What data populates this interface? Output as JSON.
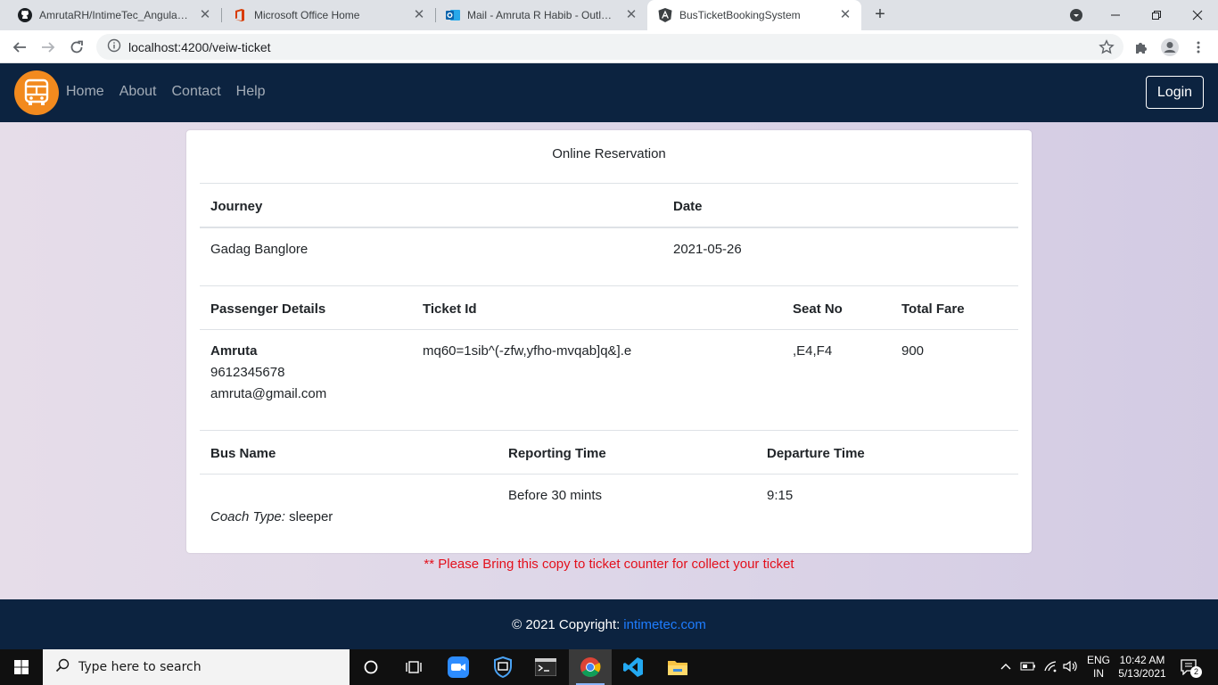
{
  "browser": {
    "tabs": [
      {
        "title": "AmrutaRH/IntimeTec_Angular_Tra"
      },
      {
        "title": "Microsoft Office Home"
      },
      {
        "title": "Mail - Amruta R Habib - Outlook"
      },
      {
        "title": "BusTicketBookingSystem"
      }
    ],
    "url": "localhost:4200/veiw-ticket"
  },
  "navbar": {
    "links": [
      "Home",
      "About",
      "Contact",
      "Help"
    ],
    "login_label": "Login"
  },
  "ticket": {
    "title": "Online Reservation",
    "journey_header": "Journey",
    "date_header": "Date",
    "journey": "Gadag Banglore",
    "date": "2021-05-26",
    "passenger_header": "Passenger Details",
    "ticket_id_header": "Ticket Id",
    "seat_header": "Seat No",
    "fare_header": "Total Fare",
    "passenger_name": "Amruta",
    "passenger_phone": "9612345678",
    "passenger_email": "amruta@gmail.com",
    "ticket_id": "mq60=1sib^(-zfw,yfho-mvqab]q&].e",
    "seat_no": ",E4,F4",
    "total_fare": "900",
    "bus_name_header": "Bus Name",
    "reporting_header": "Reporting Time",
    "departure_header": "Departure Time",
    "coach_type_label": "Coach Type:",
    "coach_type": "sleeper",
    "reporting_time": "Before 30 mints",
    "departure_time": "9:15"
  },
  "notice": "** Please Bring this copy to ticket counter for collect your ticket",
  "footer": {
    "copyright": "© 2021 Copyright:",
    "link": "intimetec.com"
  },
  "taskbar": {
    "search_placeholder": "Type here to search",
    "lang": "ENG",
    "region": "IN",
    "time": "10:42 AM",
    "date": "5/13/2021",
    "notifications": "2"
  }
}
